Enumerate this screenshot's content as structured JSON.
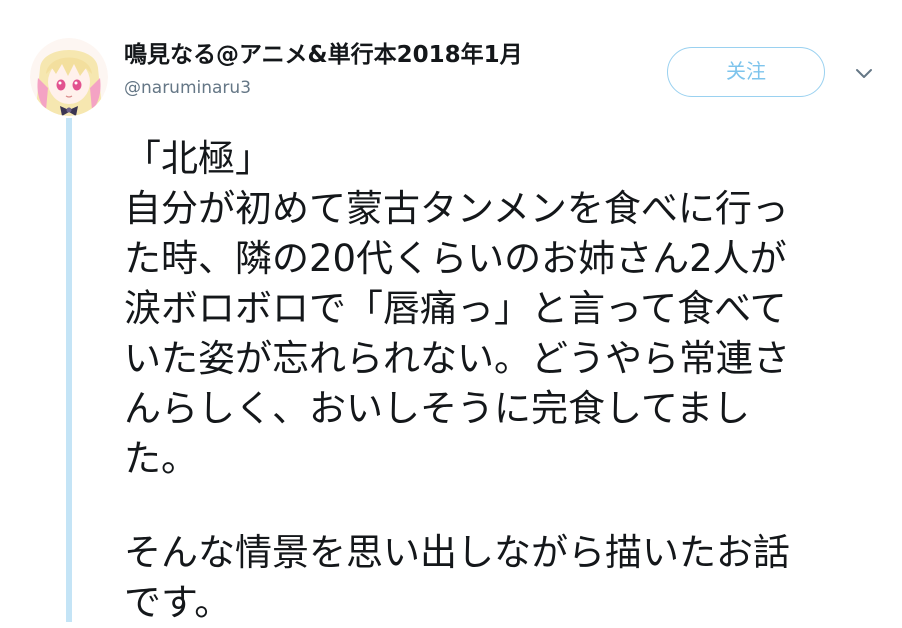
{
  "tweet": {
    "display_name": "鳴見なる@アニメ&単行本2018年1月",
    "username": "@naruminaru3",
    "follow_label": "关注",
    "accent_color": "#1da1f2",
    "follow_border_color": "#9ad1f0",
    "thread_line_color": "#c4e4f6",
    "avatar_icon": "anime-girl-avatar",
    "menu_icon": "chevron-down-icon",
    "body_lines": [
      "「北極」",
      "自分が初めて蒙古タンメンを食べに行っ",
      "た時、隣の20代くらいのお姉さん2人が",
      "涙ボロボロで「唇痛っ」と言って食べて",
      "いた姿が忘れられない。どうやら常連さ",
      "んらしく、おいしそうに完食してまし",
      "た。",
      "",
      "そんな情景を思い出しながら描いたお話",
      "です。"
    ]
  }
}
